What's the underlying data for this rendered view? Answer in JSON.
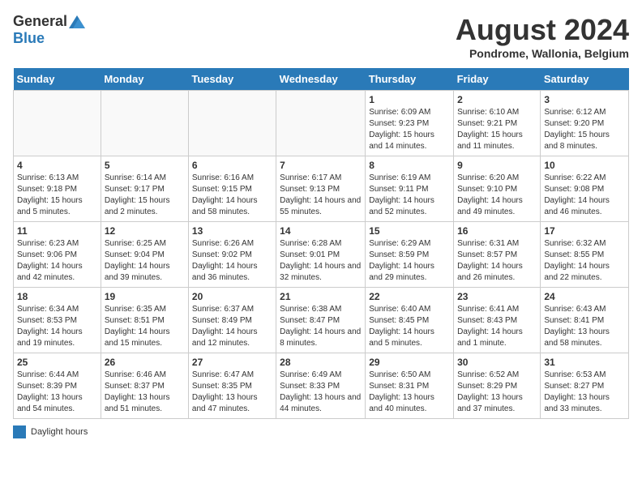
{
  "header": {
    "logo_general": "General",
    "logo_blue": "Blue",
    "month_title": "August 2024",
    "location": "Pondrome, Wallonia, Belgium"
  },
  "days_of_week": [
    "Sunday",
    "Monday",
    "Tuesday",
    "Wednesday",
    "Thursday",
    "Friday",
    "Saturday"
  ],
  "weeks": [
    [
      {
        "day": "",
        "info": ""
      },
      {
        "day": "",
        "info": ""
      },
      {
        "day": "",
        "info": ""
      },
      {
        "day": "",
        "info": ""
      },
      {
        "day": "1",
        "info": "Sunrise: 6:09 AM\nSunset: 9:23 PM\nDaylight: 15 hours and 14 minutes."
      },
      {
        "day": "2",
        "info": "Sunrise: 6:10 AM\nSunset: 9:21 PM\nDaylight: 15 hours and 11 minutes."
      },
      {
        "day": "3",
        "info": "Sunrise: 6:12 AM\nSunset: 9:20 PM\nDaylight: 15 hours and 8 minutes."
      }
    ],
    [
      {
        "day": "4",
        "info": "Sunrise: 6:13 AM\nSunset: 9:18 PM\nDaylight: 15 hours and 5 minutes."
      },
      {
        "day": "5",
        "info": "Sunrise: 6:14 AM\nSunset: 9:17 PM\nDaylight: 15 hours and 2 minutes."
      },
      {
        "day": "6",
        "info": "Sunrise: 6:16 AM\nSunset: 9:15 PM\nDaylight: 14 hours and 58 minutes."
      },
      {
        "day": "7",
        "info": "Sunrise: 6:17 AM\nSunset: 9:13 PM\nDaylight: 14 hours and 55 minutes."
      },
      {
        "day": "8",
        "info": "Sunrise: 6:19 AM\nSunset: 9:11 PM\nDaylight: 14 hours and 52 minutes."
      },
      {
        "day": "9",
        "info": "Sunrise: 6:20 AM\nSunset: 9:10 PM\nDaylight: 14 hours and 49 minutes."
      },
      {
        "day": "10",
        "info": "Sunrise: 6:22 AM\nSunset: 9:08 PM\nDaylight: 14 hours and 46 minutes."
      }
    ],
    [
      {
        "day": "11",
        "info": "Sunrise: 6:23 AM\nSunset: 9:06 PM\nDaylight: 14 hours and 42 minutes."
      },
      {
        "day": "12",
        "info": "Sunrise: 6:25 AM\nSunset: 9:04 PM\nDaylight: 14 hours and 39 minutes."
      },
      {
        "day": "13",
        "info": "Sunrise: 6:26 AM\nSunset: 9:02 PM\nDaylight: 14 hours and 36 minutes."
      },
      {
        "day": "14",
        "info": "Sunrise: 6:28 AM\nSunset: 9:01 PM\nDaylight: 14 hours and 32 minutes."
      },
      {
        "day": "15",
        "info": "Sunrise: 6:29 AM\nSunset: 8:59 PM\nDaylight: 14 hours and 29 minutes."
      },
      {
        "day": "16",
        "info": "Sunrise: 6:31 AM\nSunset: 8:57 PM\nDaylight: 14 hours and 26 minutes."
      },
      {
        "day": "17",
        "info": "Sunrise: 6:32 AM\nSunset: 8:55 PM\nDaylight: 14 hours and 22 minutes."
      }
    ],
    [
      {
        "day": "18",
        "info": "Sunrise: 6:34 AM\nSunset: 8:53 PM\nDaylight: 14 hours and 19 minutes."
      },
      {
        "day": "19",
        "info": "Sunrise: 6:35 AM\nSunset: 8:51 PM\nDaylight: 14 hours and 15 minutes."
      },
      {
        "day": "20",
        "info": "Sunrise: 6:37 AM\nSunset: 8:49 PM\nDaylight: 14 hours and 12 minutes."
      },
      {
        "day": "21",
        "info": "Sunrise: 6:38 AM\nSunset: 8:47 PM\nDaylight: 14 hours and 8 minutes."
      },
      {
        "day": "22",
        "info": "Sunrise: 6:40 AM\nSunset: 8:45 PM\nDaylight: 14 hours and 5 minutes."
      },
      {
        "day": "23",
        "info": "Sunrise: 6:41 AM\nSunset: 8:43 PM\nDaylight: 14 hours and 1 minute."
      },
      {
        "day": "24",
        "info": "Sunrise: 6:43 AM\nSunset: 8:41 PM\nDaylight: 13 hours and 58 minutes."
      }
    ],
    [
      {
        "day": "25",
        "info": "Sunrise: 6:44 AM\nSunset: 8:39 PM\nDaylight: 13 hours and 54 minutes."
      },
      {
        "day": "26",
        "info": "Sunrise: 6:46 AM\nSunset: 8:37 PM\nDaylight: 13 hours and 51 minutes."
      },
      {
        "day": "27",
        "info": "Sunrise: 6:47 AM\nSunset: 8:35 PM\nDaylight: 13 hours and 47 minutes."
      },
      {
        "day": "28",
        "info": "Sunrise: 6:49 AM\nSunset: 8:33 PM\nDaylight: 13 hours and 44 minutes."
      },
      {
        "day": "29",
        "info": "Sunrise: 6:50 AM\nSunset: 8:31 PM\nDaylight: 13 hours and 40 minutes."
      },
      {
        "day": "30",
        "info": "Sunrise: 6:52 AM\nSunset: 8:29 PM\nDaylight: 13 hours and 37 minutes."
      },
      {
        "day": "31",
        "info": "Sunrise: 6:53 AM\nSunset: 8:27 PM\nDaylight: 13 hours and 33 minutes."
      }
    ]
  ],
  "legend": {
    "label": "Daylight hours"
  }
}
